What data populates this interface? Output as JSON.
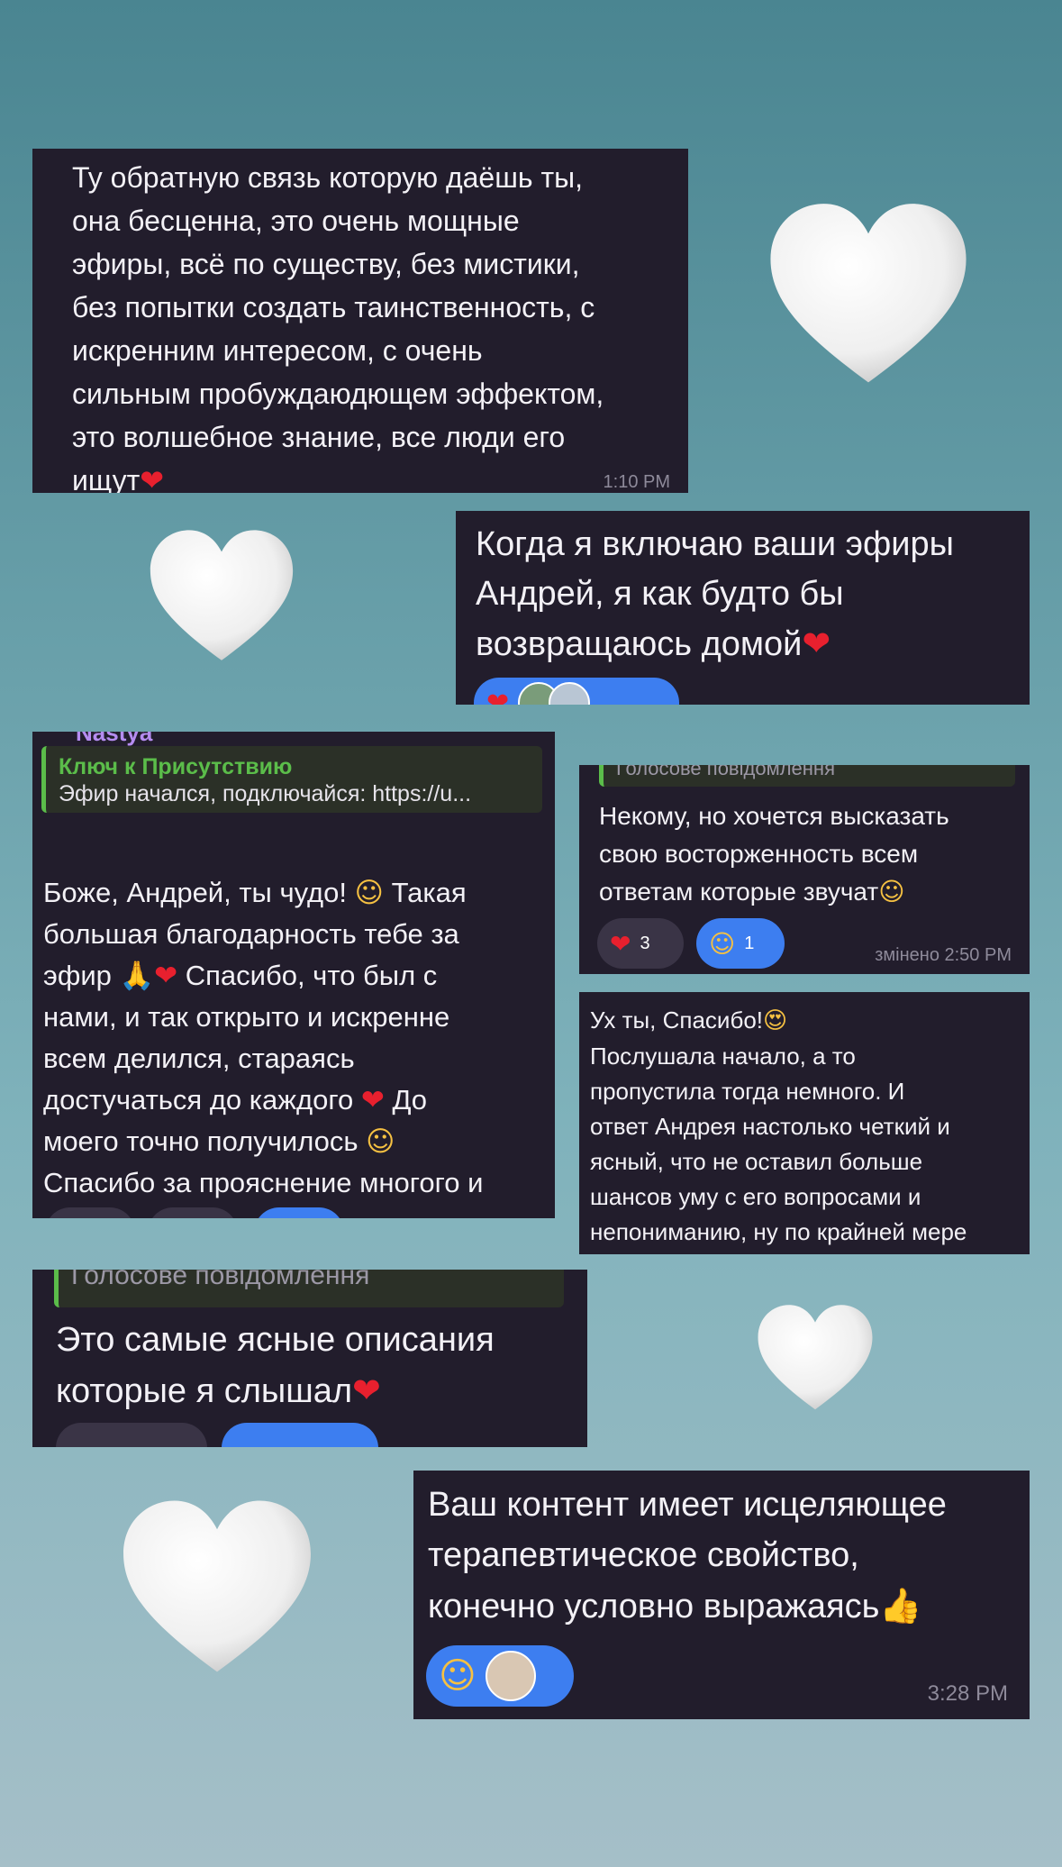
{
  "colors": {
    "bubble": "#221d2c",
    "reply_accent": "#5bbd4a",
    "reaction_blue": "#3d7ef0",
    "reaction_dark": "#3a3446",
    "heart_white": "#f3f3f3",
    "heart_red": "#e8202e"
  },
  "messages": [
    {
      "text": "Ту обратную связь которую даёшь ты,\nона бесценна, это очень мощные\nэфиры, всё по существу, без мистики,\nбез попытки создать таинственность, с\nискренним интересом, с очень\nсильным пробуждаюдющем эффектом,\nэто волшебное знание, все люди его\nищут",
      "emoji": "❤",
      "time": "1:10 PM"
    },
    {
      "text": "Когда я включаю ваши эфиры\nАндрей, я как будто бы\nвозвращаюсь домой",
      "emoji": "❤"
    },
    {
      "author": "Nastya",
      "reply_title": "Ключ к Присутствию",
      "reply_text": "Эфир начался, подключайся: https://u...",
      "text_1": "Боже, Андрей, ты чудо!",
      "emoji_1": "☺",
      "text_2": "Такая\nбольшая благодарность тебе за\nэфир",
      "emoji_2": "🙏❤",
      "text_3": "Спасибо, что был с\nнами, и так открыто и искренне\nвсем делился, стараясь\nдостучаться до каждого",
      "emoji_3": "❤",
      "text_4": "До\nмоего точно получилось",
      "emoji_4": "☺",
      "text_5": "Спасибо за прояснение многого и\nчеткие указания",
      "emoji_5": "🫶"
    },
    {
      "reply_title": "Голосове повідомлення",
      "text": "Некому, но хочется высказать\nсвою восторженность всем\nответам которые звучат",
      "emoji": "☺",
      "reactions": [
        {
          "icon": "heart-icon",
          "count": "3"
        },
        {
          "icon": "hugging-face-icon",
          "count": "1"
        }
      ],
      "time": "змінено 2:50 PM"
    },
    {
      "text_1": "Ух ты, Спасибо!",
      "emoji_1": "😍",
      "text_2": "Послушала начало, а то\nпропустила тогда немного.  И\nответ Андрея настолько четкий и\nясный, что не оставил больше\nшансов уму с его вопросами и\nнепониманию, ну по крайней мере"
    },
    {
      "reply_title": "Голосове повідомлення",
      "text": "Это самые ясные описания\nкоторые я слышал",
      "emoji": "❤"
    },
    {
      "text": "Ваш контент имеет исцеляющее\nтерапевтическое свойство,\nконечно условно выражаясь",
      "emoji": "👍",
      "time": "3:28 PM"
    }
  ]
}
